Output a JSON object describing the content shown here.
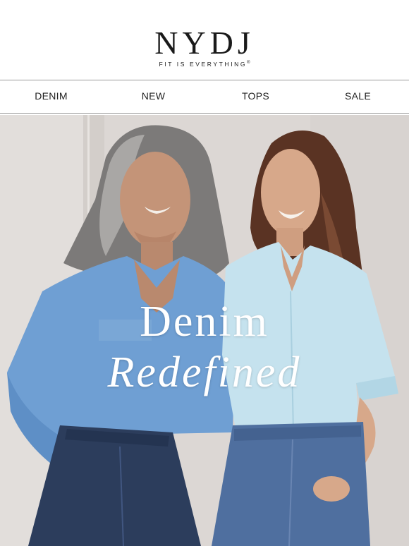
{
  "brand": {
    "logo": "NYDJ",
    "tagline": "FIT IS EVERYTHING",
    "trademark": "®"
  },
  "nav": {
    "items": [
      {
        "label": "DENIM"
      },
      {
        "label": "NEW"
      },
      {
        "label": "TOPS"
      },
      {
        "label": "SALE"
      }
    ]
  },
  "hero": {
    "headline_line1": "Denim",
    "headline_line2": "Redefined",
    "image_description_icon": "hero-photo"
  },
  "colors": {
    "text": "#1a1a1a",
    "divider": "#9a9a9a",
    "hero_background": "#dcd7d4",
    "shirt_blue": "#6f9fd3",
    "shirt_light": "#c5e2ee",
    "denim": "#2c3d5c"
  }
}
